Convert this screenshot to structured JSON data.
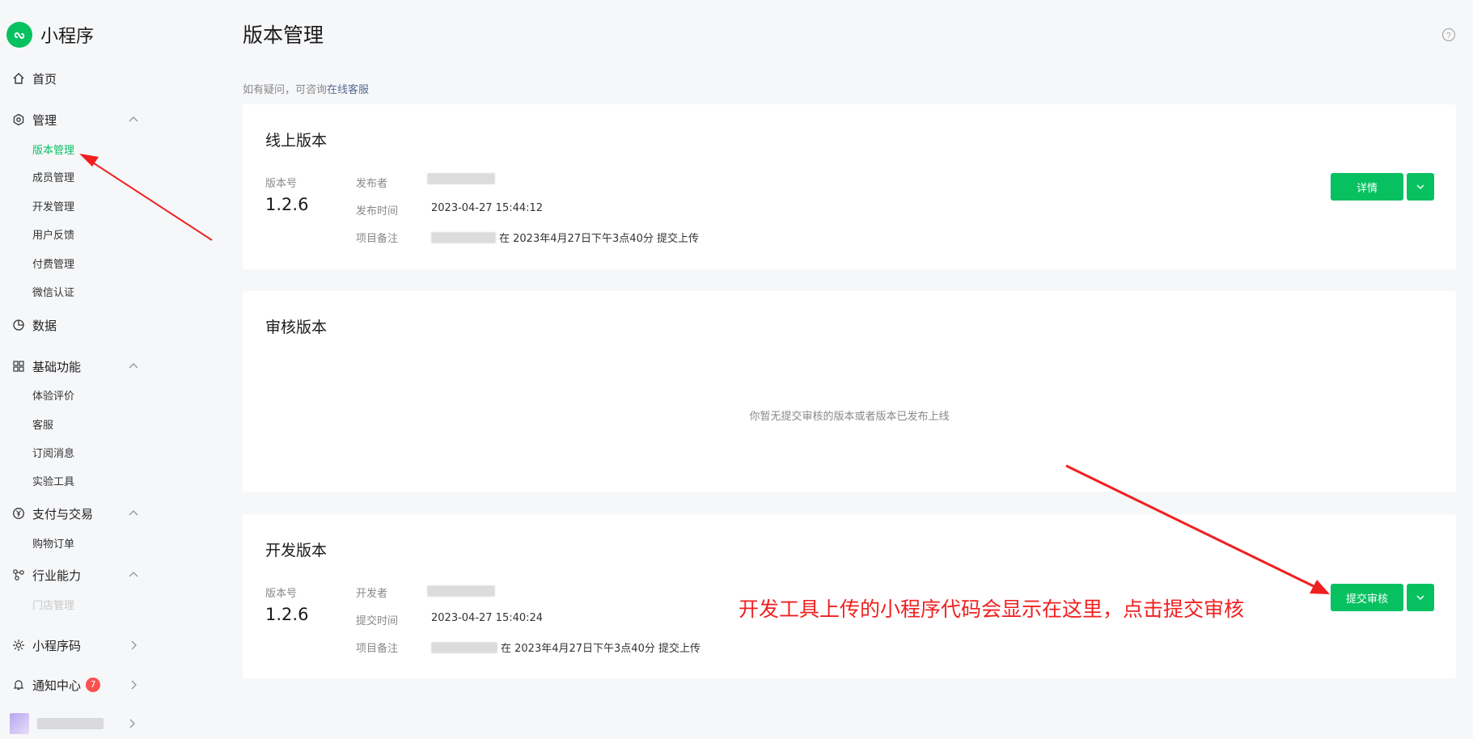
{
  "app": {
    "title": "小程序"
  },
  "colors": {
    "brand": "#07c160",
    "annotation": "#f02020",
    "link": "#576b95",
    "badge": "#fa5151"
  },
  "sidebar": {
    "home": {
      "label": "首页",
      "icon": "home-icon"
    },
    "manage": {
      "label": "管理",
      "icon": "settings-icon",
      "items": [
        {
          "label": "版本管理",
          "active": true
        },
        {
          "label": "成员管理"
        },
        {
          "label": "开发管理"
        },
        {
          "label": "用户反馈"
        },
        {
          "label": "付费管理"
        },
        {
          "label": "微信认证"
        }
      ]
    },
    "data": {
      "label": "数据",
      "icon": "pie-chart-icon"
    },
    "basic": {
      "label": "基础功能",
      "icon": "grid-icon",
      "items": [
        {
          "label": "体验评价"
        },
        {
          "label": "客服"
        },
        {
          "label": "订阅消息"
        },
        {
          "label": "实验工具"
        }
      ]
    },
    "pay": {
      "label": "支付与交易",
      "icon": "yen-icon",
      "items": [
        {
          "label": "购物订单"
        }
      ]
    },
    "industry": {
      "label": "行业能力",
      "icon": "nodes-icon",
      "items": [
        {
          "label": "门店管理"
        }
      ]
    },
    "qrcode": {
      "label": "小程序码",
      "icon": "sun-icon"
    },
    "notice": {
      "label": "通知中心",
      "icon": "bell-icon",
      "badge": "7"
    }
  },
  "main": {
    "title": "版本管理",
    "hint_prefix": "如有疑问，可咨询",
    "hint_link": "在线客服",
    "online": {
      "title": "线上版本",
      "version_label": "版本号",
      "version": "1.2.6",
      "publisher_label": "发布者",
      "time_label": "发布时间",
      "time": "2023-04-27 15:44:12",
      "note_label": "项目备注",
      "note_suffix": "在 2023年4月27日下午3点40分 提交上传",
      "detail_button": "详情"
    },
    "review": {
      "title": "审核版本",
      "empty": "你暂无提交审核的版本或者版本已发布上线"
    },
    "dev": {
      "title": "开发版本",
      "version_label": "版本号",
      "version": "1.2.6",
      "developer_label": "开发者",
      "time_label": "提交时间",
      "time": "2023-04-27 15:40:24",
      "note_label": "项目备注",
      "note_suffix": "在 2023年4月27日下午3点40分 提交上传",
      "submit_button": "提交审核"
    }
  },
  "annotation": {
    "text": "开发工具上传的小程序代码会显示在这里，点击提交审核"
  }
}
